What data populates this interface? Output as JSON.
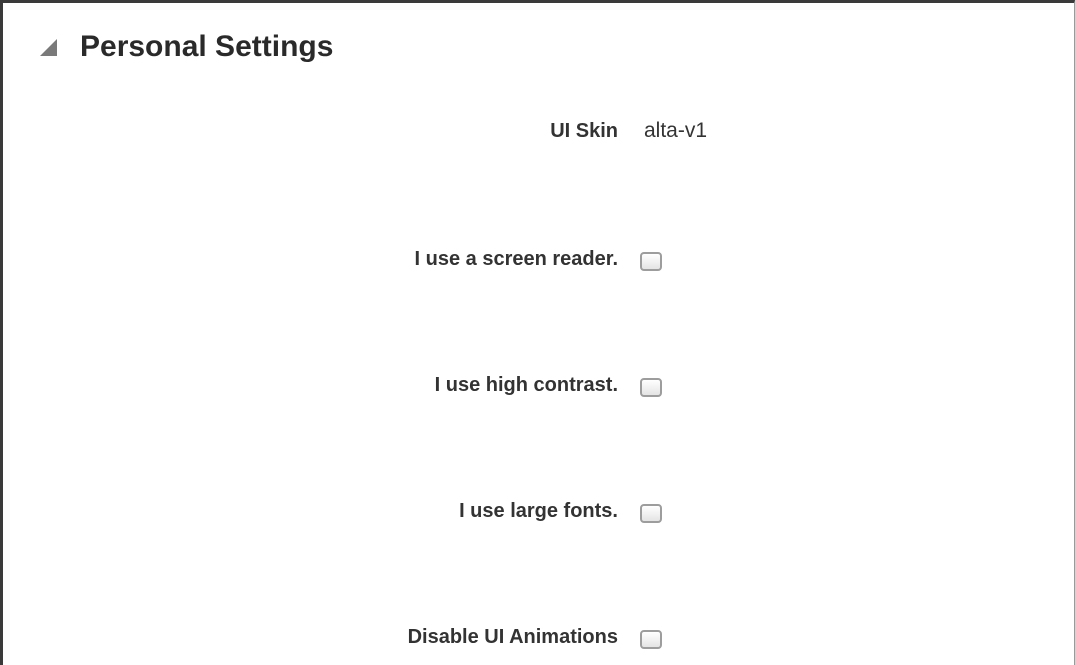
{
  "section": {
    "title": "Personal Settings",
    "expanded": true,
    "toggle_icon": "triangle-down-right-icon"
  },
  "settings": {
    "ui_skin": {
      "label": "UI Skin",
      "value": "alta-v1"
    },
    "screen_reader": {
      "label": "I use a screen reader.",
      "checked": false
    },
    "high_contrast": {
      "label": "I use high contrast.",
      "checked": false
    },
    "large_fonts": {
      "label": "I use large fonts.",
      "checked": false
    },
    "disable_animations": {
      "label": "Disable UI Animations",
      "checked": false
    }
  },
  "colors": {
    "text": "#333333",
    "title": "#2a2a2a",
    "border": "#3a3a3a",
    "checkbox_border": "#9d9d9d"
  }
}
